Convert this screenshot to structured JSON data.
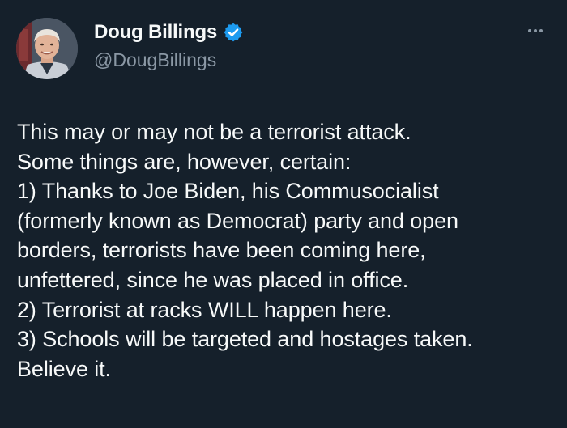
{
  "author": {
    "display_name": "Doug Billings",
    "handle": "@DougBillings",
    "verified": true,
    "avatar_icon": "profile-photo-icon",
    "verified_icon": "verified-badge-icon"
  },
  "actions": {
    "more_icon": "more-options-icon"
  },
  "tweet": {
    "lines": [
      "This may or may not be a terrorist attack.",
      "Some things are, however, certain:",
      "1) Thanks to Joe Biden, his Commusocialist",
      "(formerly known as Democrat) party and open",
      "borders, terrorists have been coming here,",
      "unfettered, since he was placed in office.",
      "2) Terrorist at racks WILL happen here.",
      "3) Schools will be targeted and hostages taken.",
      "Believe it."
    ]
  },
  "colors": {
    "background": "#15202b",
    "text": "#f7f9f9",
    "secondary_text": "#8b98a5",
    "verified_blue": "#1d9bf0"
  }
}
